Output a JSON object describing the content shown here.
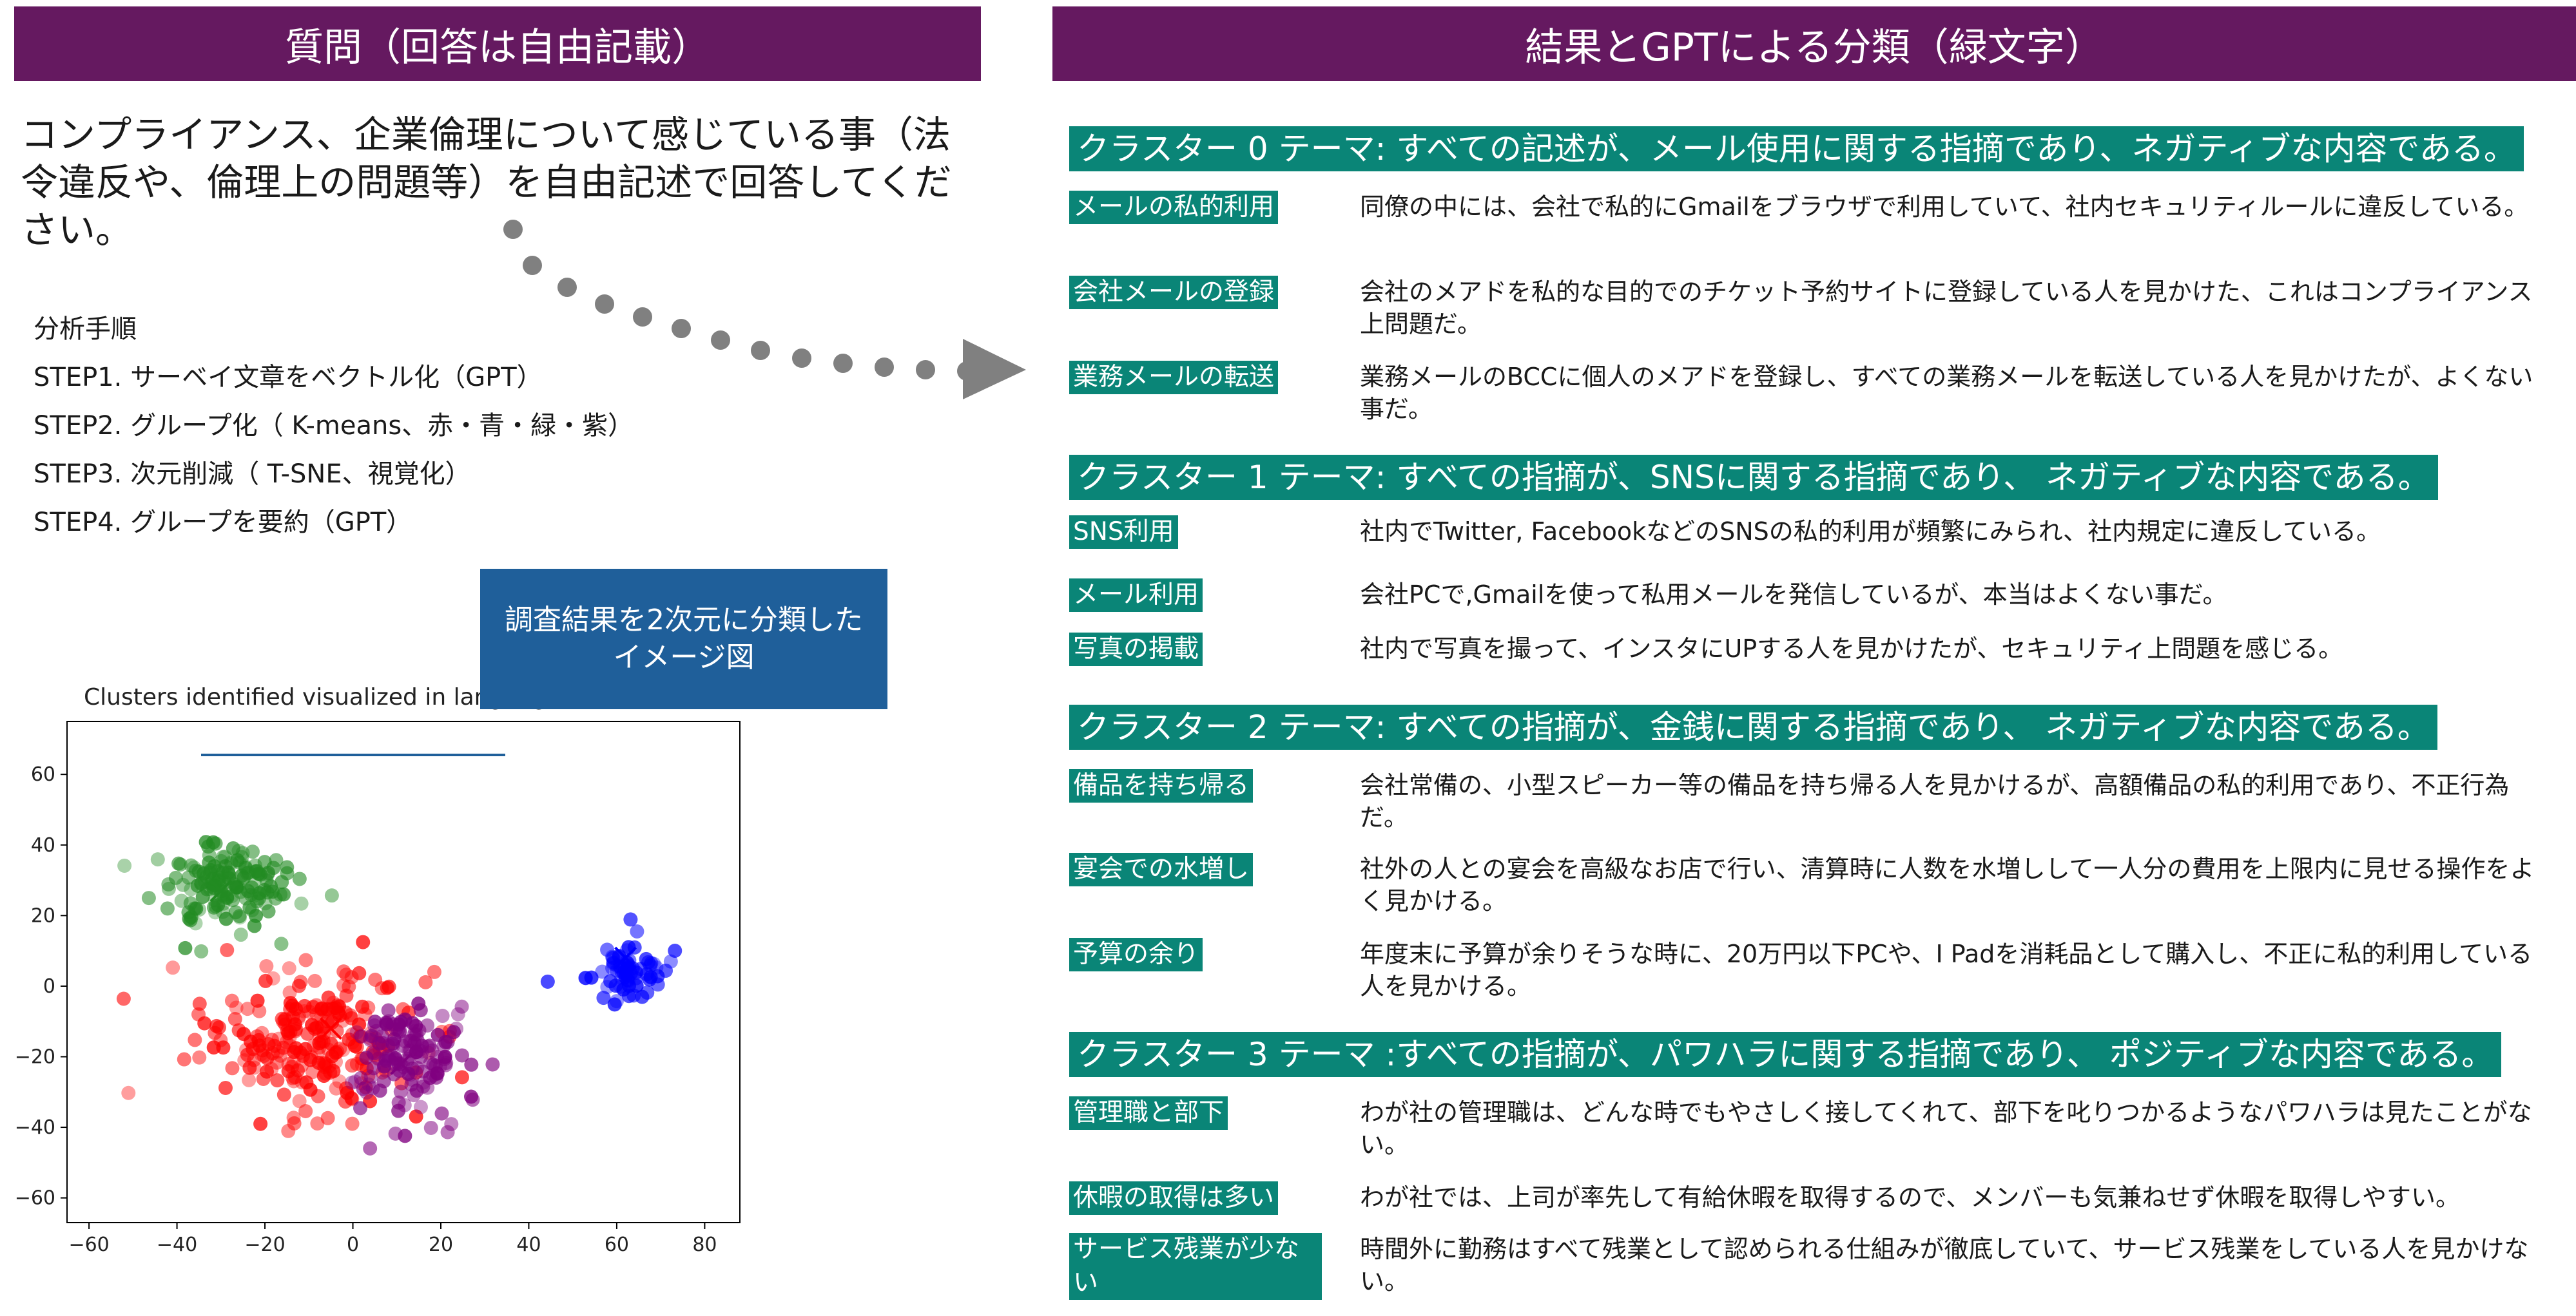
{
  "left_panel": {
    "header": "質問（回答は自由記載）",
    "question": "コンプライアンス、企業倫理について感じている事（法令違反や、倫理上の問題等）を自由記述で回答してください。",
    "steps_title": "分析手順",
    "steps": [
      "STEP1. サーベイ文章をベクトル化（GPT）",
      "STEP2. グループ化（ K-means、赤・青・緑・紫）",
      "STEP3. 次元削減（ T-SNE、視覚化）",
      "STEP4. グループを要約（GPT）"
    ],
    "callout": "調査結果を2次元に分類したイメージ図"
  },
  "chart_data": {
    "type": "scatter",
    "title": "Clusters identified visualized in language",
    "xlim": [
      -65,
      88
    ],
    "ylim": [
      -67,
      75
    ],
    "x_ticks": [
      -60,
      -40,
      -20,
      0,
      20,
      40,
      60,
      80
    ],
    "y_ticks": [
      60,
      40,
      20,
      0,
      -20,
      -40,
      -60
    ],
    "series": [
      {
        "color": "#ff0000",
        "center": [
          -10,
          -15
        ],
        "spread": [
          22,
          18
        ],
        "count": 240,
        "centroid": [
          -5,
          -12
        ]
      },
      {
        "color": "#228b22",
        "center": [
          -30,
          28
        ],
        "spread": [
          14,
          11
        ],
        "count": 150,
        "centroid": [
          -30,
          27
        ]
      },
      {
        "color": "#0000ff",
        "center": [
          62,
          5
        ],
        "spread": [
          8,
          8
        ],
        "count": 70,
        "centroid": [
          62,
          8
        ]
      },
      {
        "color": "#800080",
        "center": [
          12,
          -20
        ],
        "spread": [
          13,
          14
        ],
        "count": 140,
        "centroid": [
          11,
          -22
        ]
      }
    ]
  },
  "right_panel": {
    "header": "結果とGPTによる分類（緑文字）",
    "clusters": [
      {
        "title": "クラスター 0 テーマ: すべての記述が、メール使用に関する指摘であり、ネガティブな内容である。",
        "items": [
          {
            "label": "メールの私的利用",
            "text": "同僚の中には、会社で私的にGmailをブラウザで利用していて、社内セキュリティルールに違反している。"
          },
          {
            "label": "会社メールの登録",
            "text": "会社のメアドを私的な目的でのチケット予約サイトに登録している人を見かけた、これはコンプライアンス上問題だ。"
          },
          {
            "label": "業務メールの転送",
            "text": "業務メールのBCCに個人のメアドを登録し、すべての業務メールを転送している人を見かけたが、よくない事だ。"
          }
        ]
      },
      {
        "title": "クラスター 1 テーマ: すべての指摘が、SNSに関する指摘であり、 ネガティブな内容である。",
        "items": [
          {
            "label": "SNS利用",
            "text": "社内でTwitter, FacebookなどのSNSの私的利用が頻繁にみられ、社内規定に違反している。"
          },
          {
            "label": "メール利用",
            "text": "会社PCで,Gmailを使って私用メールを発信しているが、本当はよくない事だ。"
          },
          {
            "label": "写真の掲載",
            "text": "社内で写真を撮って、インスタにUPする人を見かけたが、セキュリティ上問題を感じる。"
          }
        ]
      },
      {
        "title": "クラスター 2 テーマ: すべての指摘が、金銭に関する指摘であり、 ネガティブな内容である。",
        "items": [
          {
            "label": "備品を持ち帰る",
            "text": "会社常備の、小型スピーカー等の備品を持ち帰る人を見かけるが、高額備品の私的利用であり、不正行為だ。"
          },
          {
            "label": "宴会での水増し",
            "text": "社外の人との宴会を高級なお店で行い、清算時に人数を水増しして一人分の費用を上限内に見せる操作をよく見かける。"
          },
          {
            "label": "予算の余り",
            "text": "年度末に予算が余りそうな時に、20万円以下PCや、I Padを消耗品として購入し、不正に私的利用している人を見かける。"
          }
        ]
      },
      {
        "title": "クラスター 3 テーマ :すべての指摘が、パワハラに関する指摘であり、 ポジティブな内容である。",
        "items": [
          {
            "label": "管理職と部下",
            "text": "わが社の管理職は、どんな時でもやさしく接してくれて、部下を叱りつかるようなパワハラは見たことがない。"
          },
          {
            "label": "休暇の取得は多い",
            "text": "わが社では、上司が率先して有給休暇を取得するので、メンバーも気兼ねせず休暇を取得しやすい。"
          },
          {
            "label": "サービス残業が少ない",
            "text": "時間外に勤務はすべて残業として認められる仕組みが徹底していて、サービス残業をしている人を見かけない。"
          }
        ]
      }
    ]
  }
}
